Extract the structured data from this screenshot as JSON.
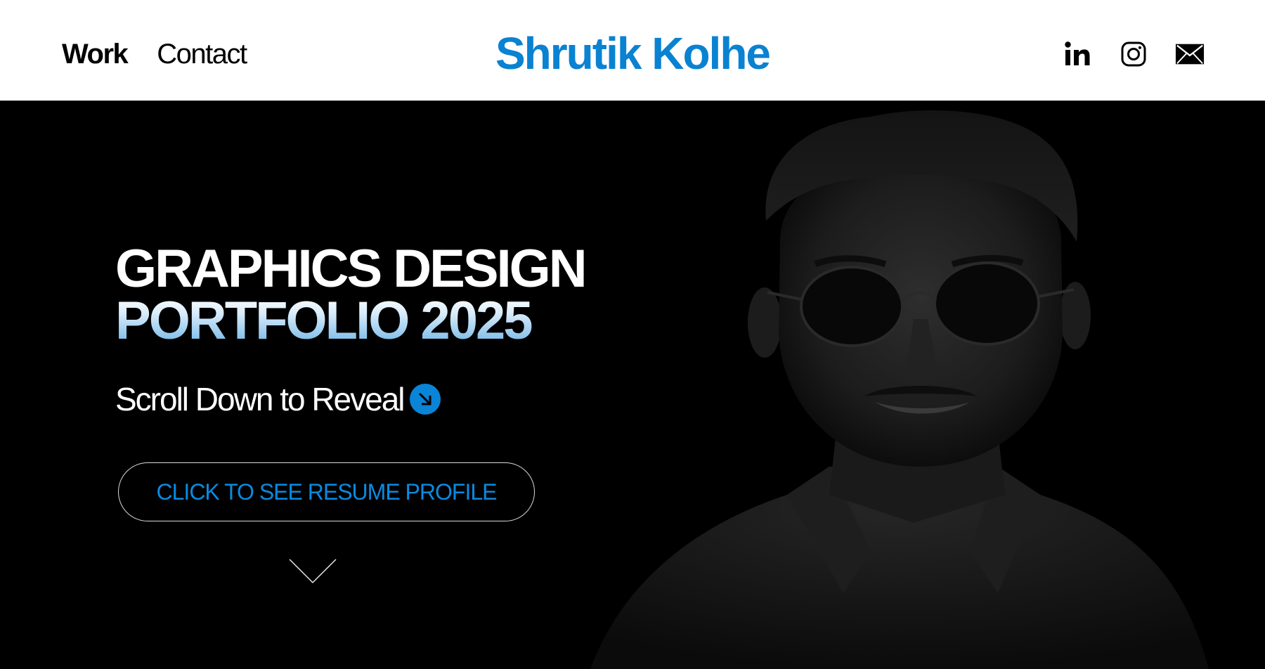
{
  "header": {
    "nav": [
      {
        "label": "Work",
        "active": true
      },
      {
        "label": "Contact",
        "active": false
      }
    ],
    "brand": "Shrutik Kolhe",
    "social_icons": [
      "linkedin-icon",
      "instagram-icon",
      "mail-icon"
    ]
  },
  "hero": {
    "title_line1": "GRAPHICS DESIGN",
    "title_line2": "PORTFOLIO 2025",
    "scroll_text": "Scroll Down to Reveal",
    "scroll_icon": "arrow-down-right-icon",
    "resume_button": "CLICK TO SEE RESUME PROFILE",
    "scroll_indicator_icon": "chevron-down-icon"
  },
  "colors": {
    "accent": "#0A84D6",
    "brand_text": "#0A82D2",
    "button_text": "#0A8AE0",
    "hero_bg": "#000000",
    "header_bg": "#FFFFFF"
  }
}
